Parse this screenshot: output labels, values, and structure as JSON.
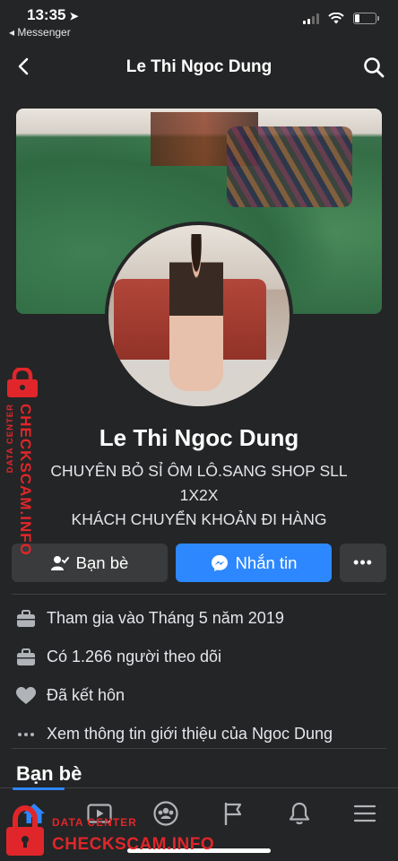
{
  "status": {
    "time": "13:35",
    "back_app": "◂ Messenger",
    "battery_level": 0.25
  },
  "nav": {
    "title": "Le Thi Ngoc Dung"
  },
  "profile": {
    "name": "Le Thi Ngoc Dung",
    "bio": [
      "CHUYÊN BỎ SỈ ÔM LÔ.SANG SHOP SLL",
      "1X2X",
      "KHÁCH CHUYỂN KHOẢN ĐI HÀNG"
    ]
  },
  "actions": {
    "friends_label": "Bạn bè",
    "message_label": "Nhắn tin",
    "more_label": "•••"
  },
  "info": [
    {
      "icon": "briefcase-icon",
      "text": "Tham gia vào Tháng 5 năm 2019"
    },
    {
      "icon": "briefcase-icon",
      "text": "Có 1.266 người theo dõi"
    },
    {
      "icon": "heart-icon",
      "text": "Đã kết hôn"
    },
    {
      "icon": "more-dots-icon",
      "text": "Xem thông tin giới thiệu của Ngoc Dung"
    }
  ],
  "section": {
    "friends_title": "Bạn bè"
  },
  "tabs": [
    "home-icon",
    "video-icon",
    "groups-icon",
    "pages-flag-icon",
    "bell-icon",
    "menu-icon"
  ],
  "watermark": {
    "line1": "DATA CENTER",
    "line2": "CHECKSCAM.INFO"
  },
  "colors": {
    "background": "#242526",
    "accent": "#2d88ff",
    "watermark": "#e0262a"
  }
}
